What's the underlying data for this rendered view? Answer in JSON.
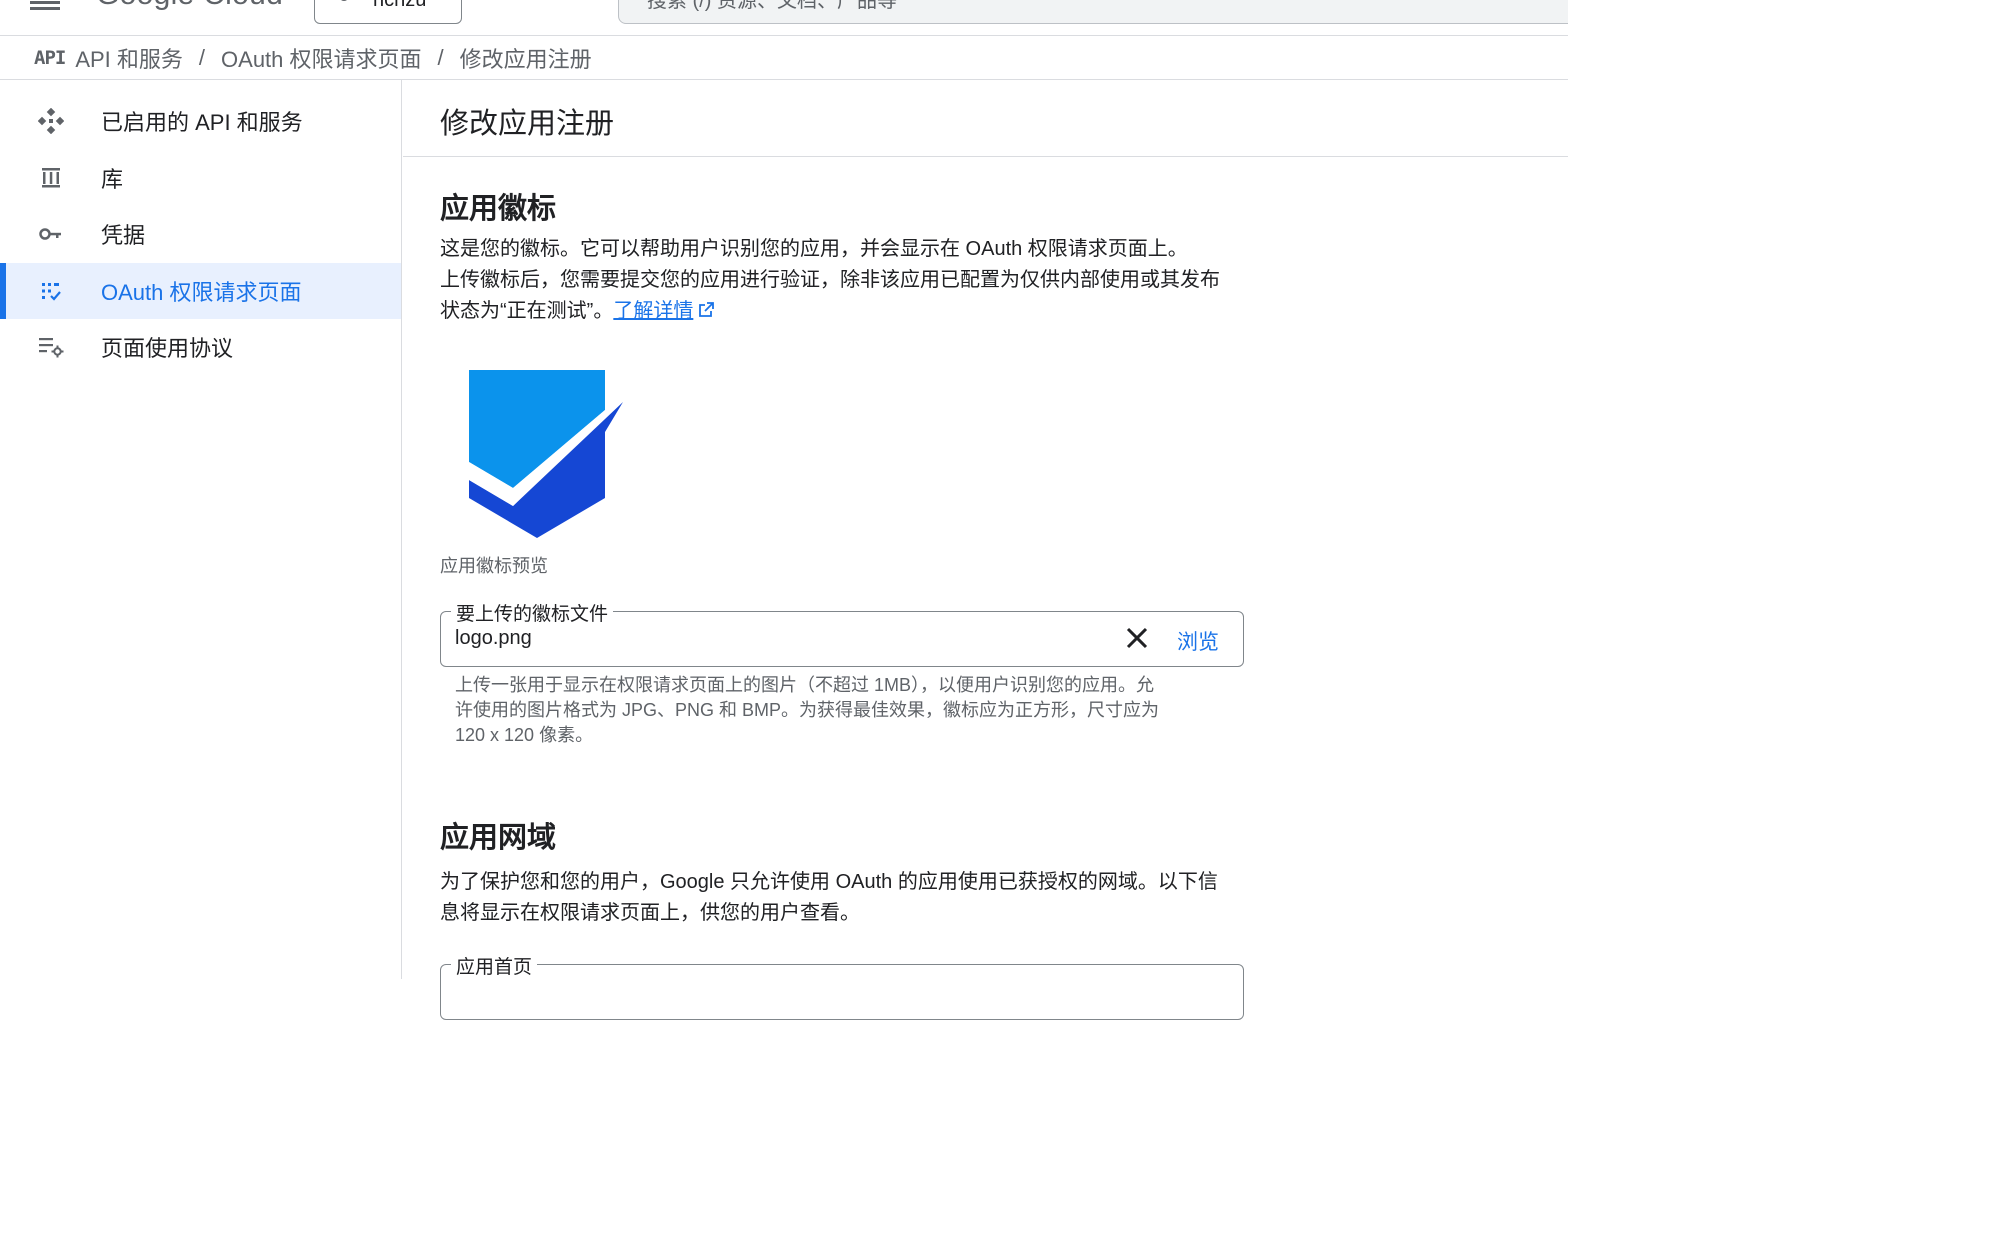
{
  "header": {
    "logo_text": "Google Cloud",
    "project_label": "ncnzu",
    "search_placeholder": "搜索 (/) 资源、文档、产品等"
  },
  "breadcrumb": {
    "badge": "API",
    "items": [
      "API 和服务",
      "OAuth 权限请求页面",
      "修改应用注册"
    ],
    "separator": "/"
  },
  "sidebar": {
    "items": [
      {
        "label": "已启用的 API 和服务",
        "icon": "api-services-icon",
        "active": false
      },
      {
        "label": "库",
        "icon": "library-icon",
        "active": false
      },
      {
        "label": "凭据",
        "icon": "key-icon",
        "active": false
      },
      {
        "label": "OAuth 权限请求页面",
        "icon": "oauth-consent-icon",
        "active": true
      },
      {
        "label": "页面使用协议",
        "icon": "page-usage-icon",
        "active": false
      }
    ]
  },
  "main": {
    "title": "修改应用注册",
    "logo_section": {
      "title": "应用徽标",
      "description_line1": "这是您的徽标。它可以帮助用户识别您的应用，并会显示在 OAuth 权限请求页面上。",
      "description_line2": "上传徽标后，您需要提交您的应用进行验证，除非该应用已配置为仅供内部使用或其发布",
      "description_line3": "状态为“正在测试”。",
      "learn_more": "了解详情",
      "preview_caption": "应用徽标预览",
      "file_field_label": "要上传的徽标文件",
      "file_field_value": "logo.png",
      "browse_label": "浏览",
      "hint_line1": "上传一张用于显示在权限请求页面上的图片（不超过 1MB），以便用户识别您的应用。允",
      "hint_line2": "许使用的图片格式为 JPG、PNG 和 BMP。为获得最佳效果，徽标应为正方形，尺寸应为",
      "hint_line3": "120 x 120 像素。"
    },
    "domain_section": {
      "title": "应用网域",
      "description_line1": "为了保护您和您的用户，Google 只允许使用 OAuth 的应用使用已获授权的网域。以下信",
      "description_line2": "息将显示在权限请求页面上，供您的用户查看。",
      "homepage_field_label": "应用首页"
    }
  },
  "colors": {
    "accent": "#1a73e8",
    "active_nav_bg": "#e8f0fe",
    "logo_light_blue": "#0b93ec",
    "logo_dark_blue": "#1547d4"
  }
}
